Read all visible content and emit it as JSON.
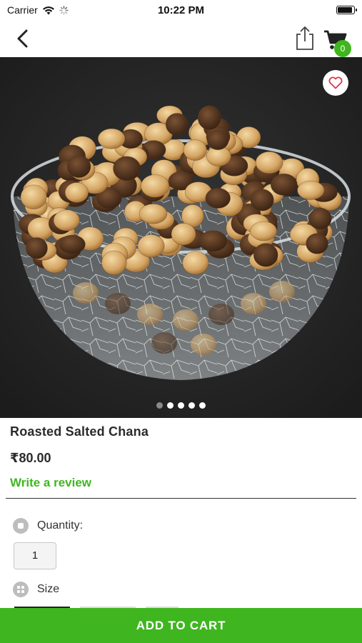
{
  "status_bar": {
    "carrier": "Carrier",
    "time": "10:22 PM",
    "battery_level": 0.95
  },
  "nav": {
    "cart_count": "0",
    "icons": [
      "back-chevron-icon",
      "share-icon",
      "cart-icon"
    ]
  },
  "gallery": {
    "image_count": 5,
    "active_index": 0,
    "image_subject": "glass bowl of roasted chana"
  },
  "product": {
    "title": "Roasted Salted Chana",
    "price": "₹80.00",
    "review_link": "Write a review"
  },
  "options": {
    "quantity_label": "Quantity:",
    "quantity_value": "1",
    "size_label": "Size"
  },
  "cta": {
    "add_to_cart": "ADD TO CART"
  },
  "colors": {
    "accent": "#3fb61f",
    "hero_bg": "#262626",
    "wishlist": "#e0324f"
  }
}
